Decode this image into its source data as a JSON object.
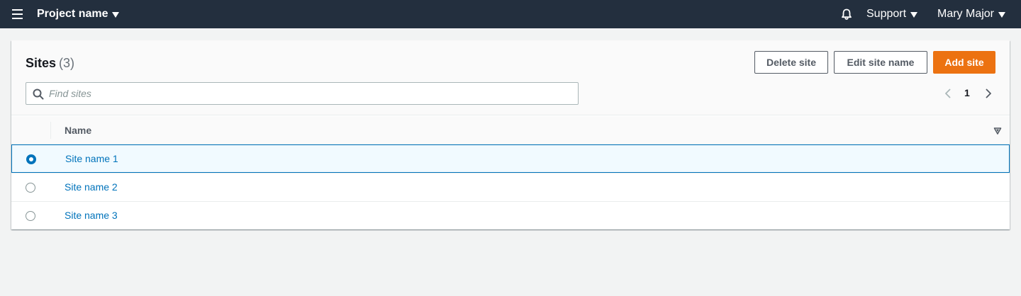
{
  "topnav": {
    "project_name": "Project name",
    "support_label": "Support",
    "user_name": "Mary Major",
    "icons": [
      "menu-icon",
      "bell-icon",
      "caret-down-icon"
    ]
  },
  "sites_panel": {
    "title": "Sites",
    "count": "(3)",
    "buttons": {
      "delete": "Delete site",
      "edit": "Edit site name",
      "add": "Add site"
    },
    "search": {
      "placeholder": "Find sites",
      "value": ""
    },
    "pagination": {
      "current_page": "1"
    }
  },
  "table": {
    "columns": [
      "Name"
    ],
    "rows": [
      {
        "name": "Site name 1",
        "selected": true
      },
      {
        "name": "Site name 2",
        "selected": false
      },
      {
        "name": "Site name 3",
        "selected": false
      }
    ]
  },
  "colors": {
    "nav_bg": "#232f3e",
    "primary_orange": "#ec7211",
    "link_blue": "#0073bb",
    "selected_row_bg": "#f1faff"
  }
}
